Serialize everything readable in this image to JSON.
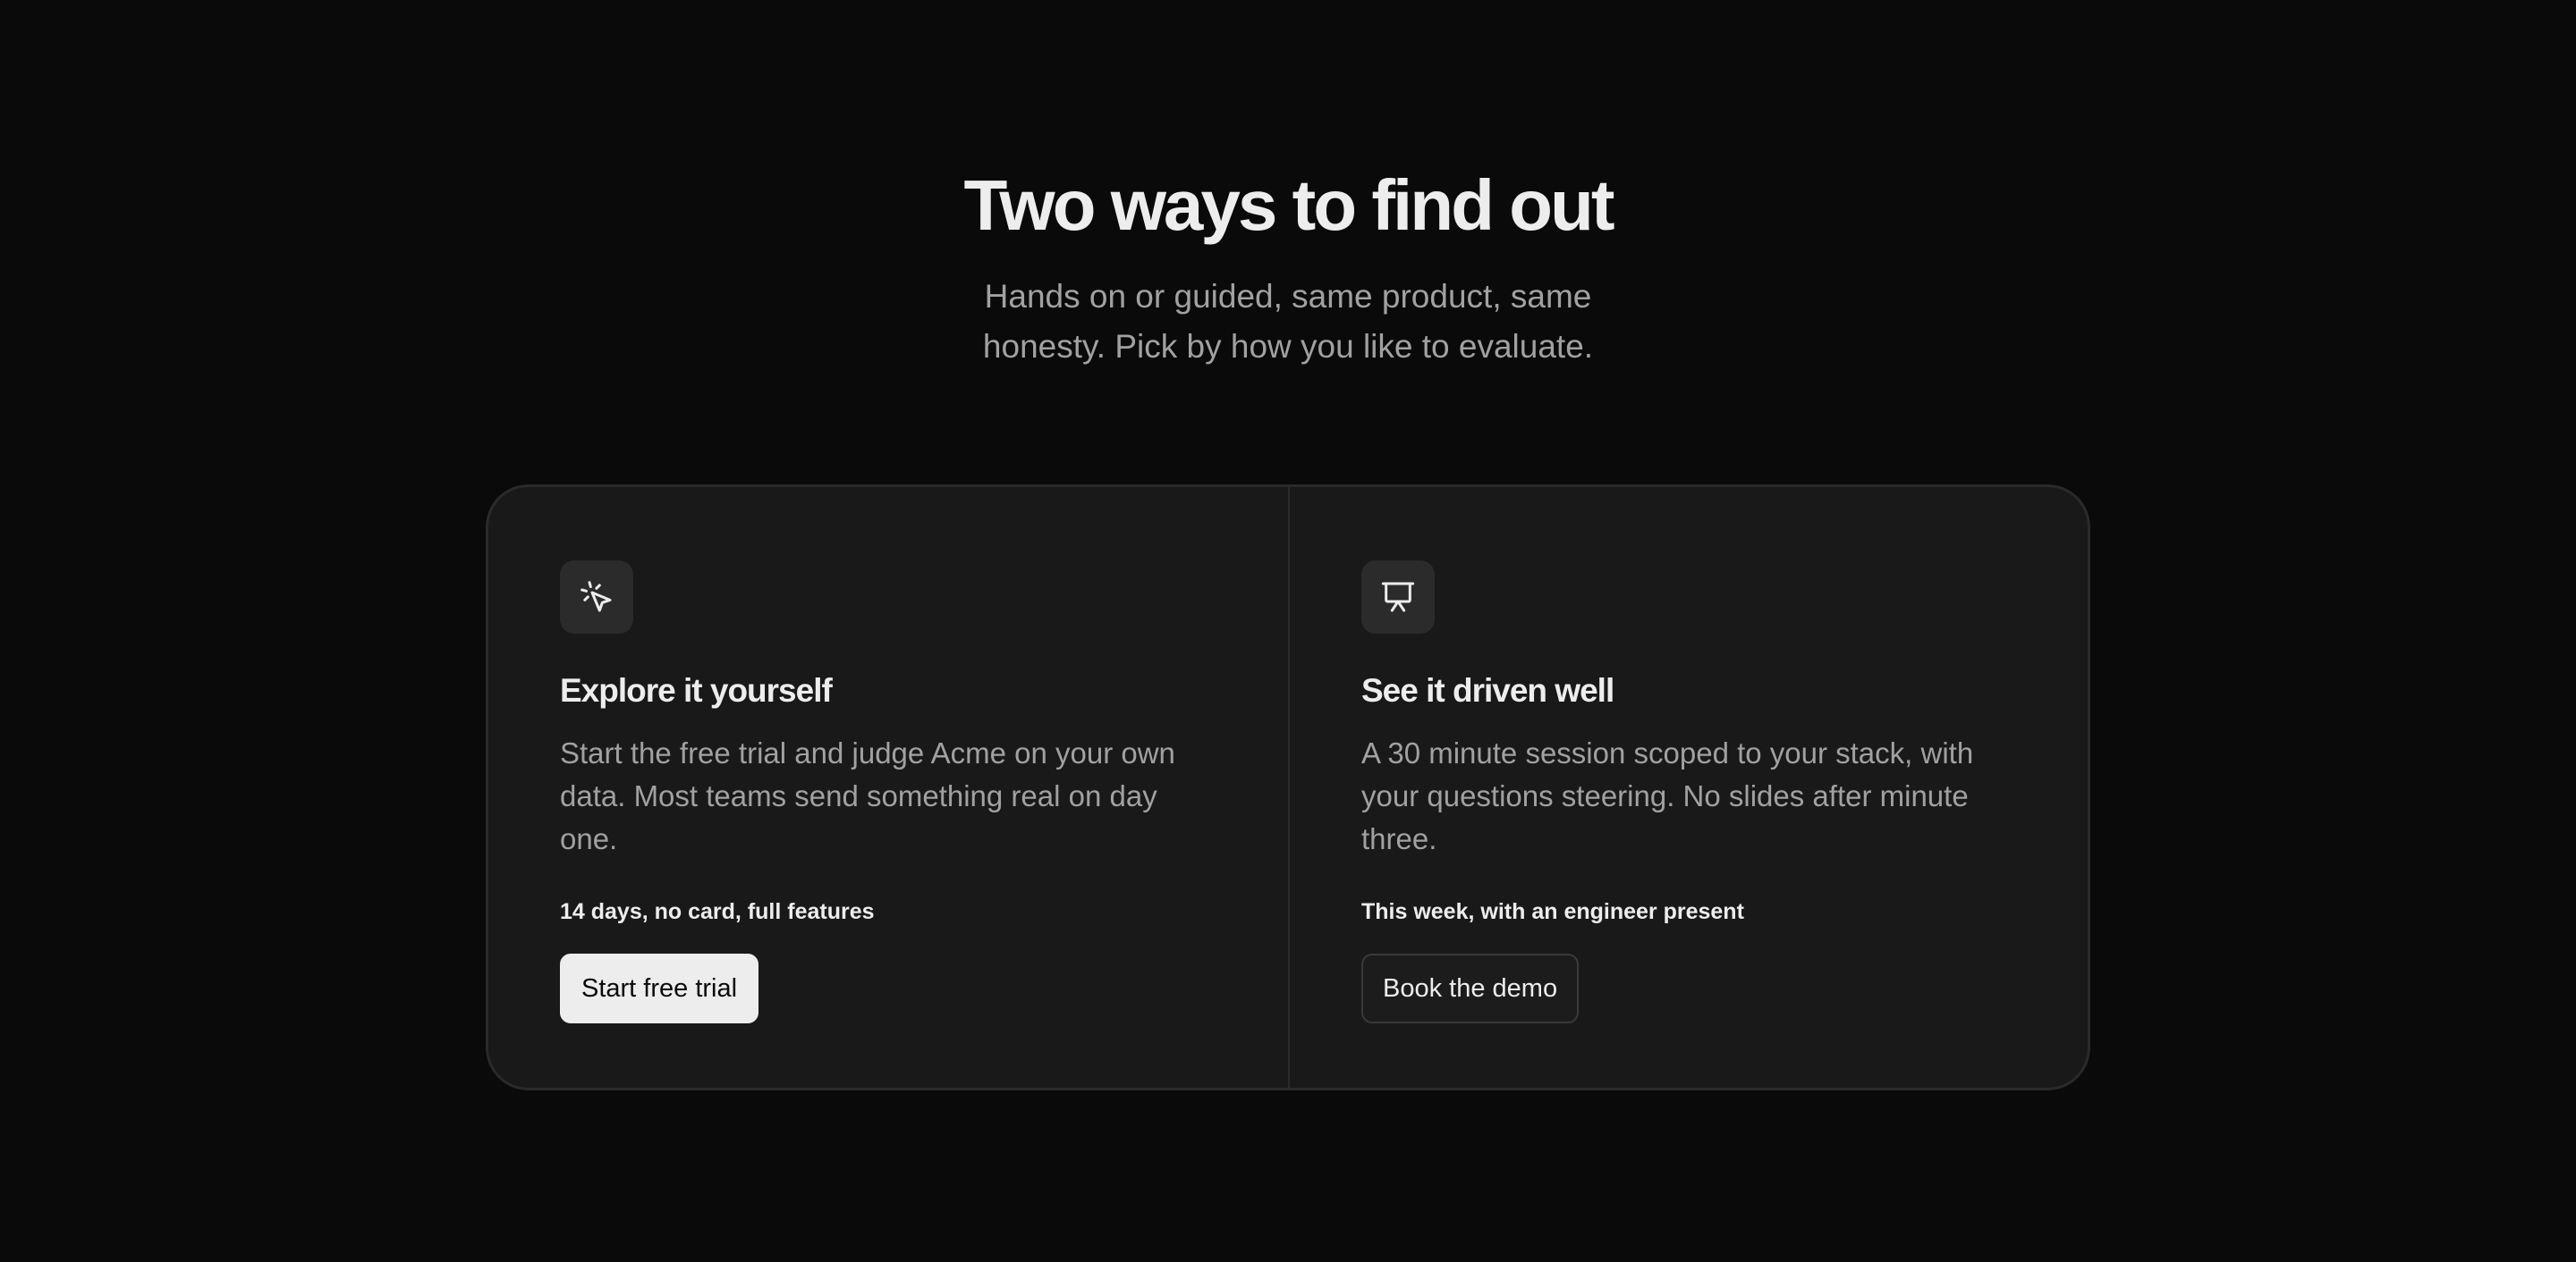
{
  "header": {
    "title": "Two ways to find out",
    "subtitle": "Hands on or guided, same product, same honesty. Pick by how you like to evaluate."
  },
  "cards": [
    {
      "icon": "cursor-click-icon",
      "title": "Explore it yourself",
      "description": "Start the free trial and judge Acme on your own data. Most teams send something real on day one.",
      "meta": "14 days, no card, full features",
      "button_label": "Start free trial"
    },
    {
      "icon": "presentation-icon",
      "title": "See it driven well",
      "description": "A 30 minute session scoped to your stack, with your questions steering. No slides after minute three.",
      "meta": "This week, with an engineer present",
      "button_label": "Book the demo"
    }
  ],
  "colors": {
    "background": "#0a0a0a",
    "panel": "#191919",
    "text": "#ededed",
    "muted": "#a1a1a1"
  }
}
